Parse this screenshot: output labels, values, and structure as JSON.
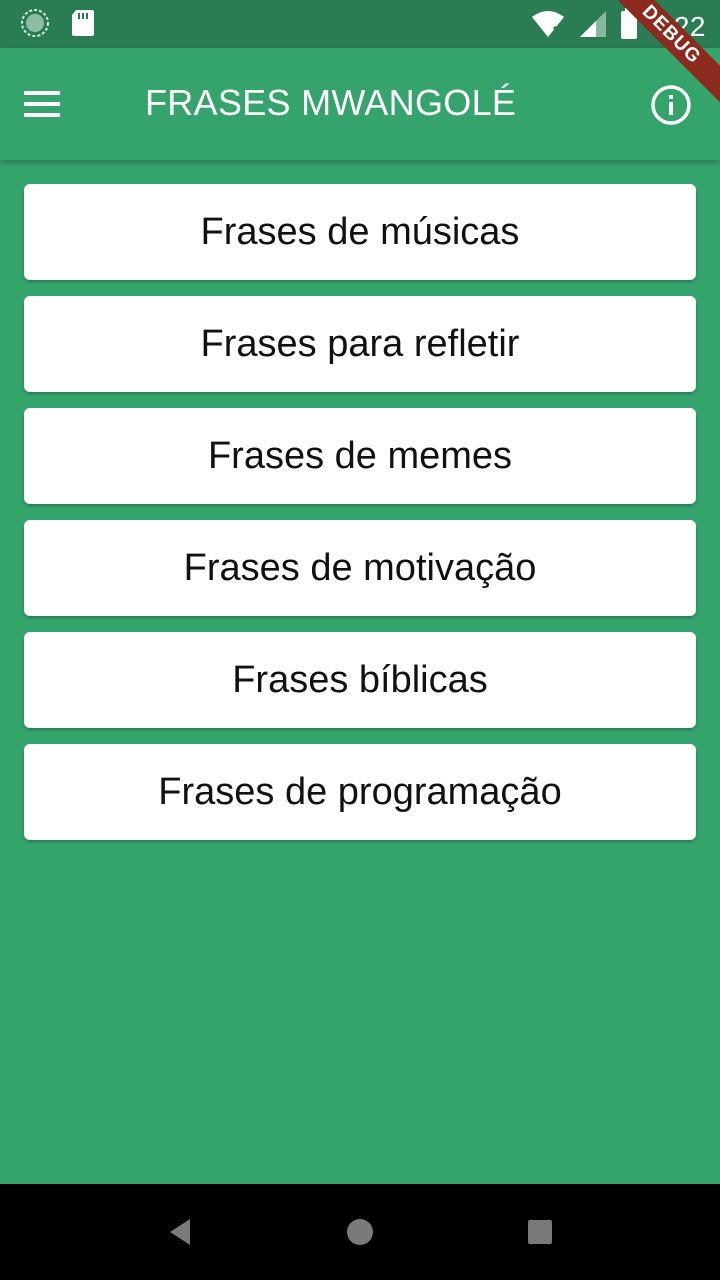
{
  "status_bar": {
    "time": "7:22",
    "icons": [
      "sync-icon",
      "sd-card-icon",
      "wifi-off-icon",
      "cell-signal-icon",
      "battery-icon"
    ]
  },
  "app_bar": {
    "title": "FRASES MWANGOLÉ",
    "menu_icon": "hamburger-menu-icon",
    "info_icon": "info-icon",
    "color": "#35a46c"
  },
  "debug_banner": {
    "label": "DEBUG"
  },
  "categories": [
    "Frases de músicas",
    "Frases para refletir",
    "Frases de memes",
    "Frases de motivação",
    "Frases bíblicas",
    "Frases de programação"
  ],
  "navigation": {
    "buttons": [
      "back-icon",
      "home-icon",
      "recents-icon"
    ]
  }
}
